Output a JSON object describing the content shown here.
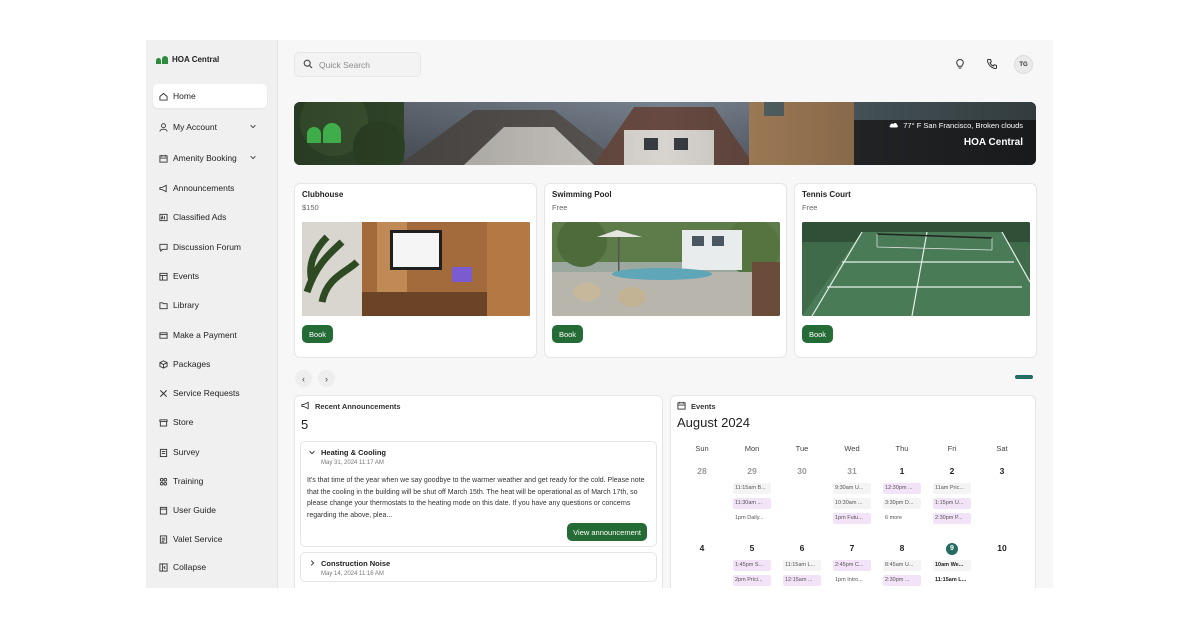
{
  "app": {
    "name": "HOA Central"
  },
  "sidebar": {
    "items": [
      {
        "label": "Home",
        "icon": "home-icon"
      },
      {
        "label": "My Account",
        "icon": "user-icon"
      },
      {
        "label": "Amenity Booking",
        "icon": "calendar-icon"
      },
      {
        "label": "Announcements",
        "icon": "megaphone-icon"
      },
      {
        "label": "Classified Ads",
        "icon": "ad-icon"
      },
      {
        "label": "Discussion Forum",
        "icon": "chat-icon"
      },
      {
        "label": "Events",
        "icon": "events-icon"
      },
      {
        "label": "Library",
        "icon": "folder-icon"
      },
      {
        "label": "Make a Payment",
        "icon": "payment-icon"
      },
      {
        "label": "Packages",
        "icon": "package-icon"
      },
      {
        "label": "Service Requests",
        "icon": "tools-icon"
      },
      {
        "label": "Store",
        "icon": "store-icon"
      },
      {
        "label": "Survey",
        "icon": "survey-icon"
      },
      {
        "label": "Training",
        "icon": "training-icon"
      },
      {
        "label": "User Guide",
        "icon": "book-icon"
      },
      {
        "label": "Valet Service",
        "icon": "valet-icon"
      },
      {
        "label": "Collapse",
        "icon": "collapse-icon"
      }
    ]
  },
  "search": {
    "placeholder": "Quick Search"
  },
  "header": {
    "avatar_initials": "TG"
  },
  "banner": {
    "weather": "77° F  San Francisco,  Broken clouds",
    "title": "HOA Central"
  },
  "amenities": [
    {
      "name": "Clubhouse",
      "price": "$150",
      "button": "Book"
    },
    {
      "name": "Swimming Pool",
      "price": "Free",
      "button": "Book"
    },
    {
      "name": "Tennis Court",
      "price": "Free",
      "button": "Book"
    }
  ],
  "announcements": {
    "title": "Recent Announcements",
    "count": "5",
    "items": [
      {
        "title": "Heating & Cooling",
        "date": "May 31, 2024 11:17 AM",
        "body": "It's that time of the year when we say goodbye to the warmer weather and get ready for the cold. Please note that the cooling in the building will be shut off March 15th. The heat will be operational as of March 17th, so please change your thermostats to the heating mode on this date. If you have any questions or concerns regarding the above, plea...",
        "button": "View announcement"
      },
      {
        "title": "Construction Noise",
        "date": "May 14, 2024 11:16 AM"
      }
    ]
  },
  "events": {
    "title": "Events",
    "month": "August 2024",
    "weekdays": [
      "Sun",
      "Mon",
      "Tue",
      "Wed",
      "Thu",
      "Fri",
      "Sat"
    ],
    "week1": [
      "28",
      "29",
      "30",
      "31",
      "1",
      "2",
      "3"
    ],
    "week2": [
      "4",
      "5",
      "6",
      "7",
      "8",
      "9",
      "10"
    ],
    "week1_events": {
      "mon": [
        "11:15am B...",
        "11:30am ...",
        "1pm Daily..."
      ],
      "wed": [
        "9:30am U...",
        "10:30am ...",
        "1pm Futu..."
      ],
      "thu": [
        "12:30pm ...",
        "3:30pm D...",
        "6 more"
      ],
      "fri": [
        "11am Pric...",
        "1:15pm U...",
        "2:30pm P..."
      ]
    },
    "week2_events": {
      "mon": [
        "1:45pm S...",
        "2pm Prici..."
      ],
      "tue": [
        "11:15am L...",
        "12:15am ..."
      ],
      "wed": [
        "2:45pm C...",
        "1pm Intro..."
      ],
      "thu": [
        "8:45am U...",
        "2:30pm ..."
      ],
      "fri": [
        "10am We...",
        "11:15am L..."
      ]
    }
  },
  "colors": {
    "accent": "#256b36",
    "sidebar_bg": "#f0f0f0",
    "event_pink": "#f3e3f8"
  }
}
